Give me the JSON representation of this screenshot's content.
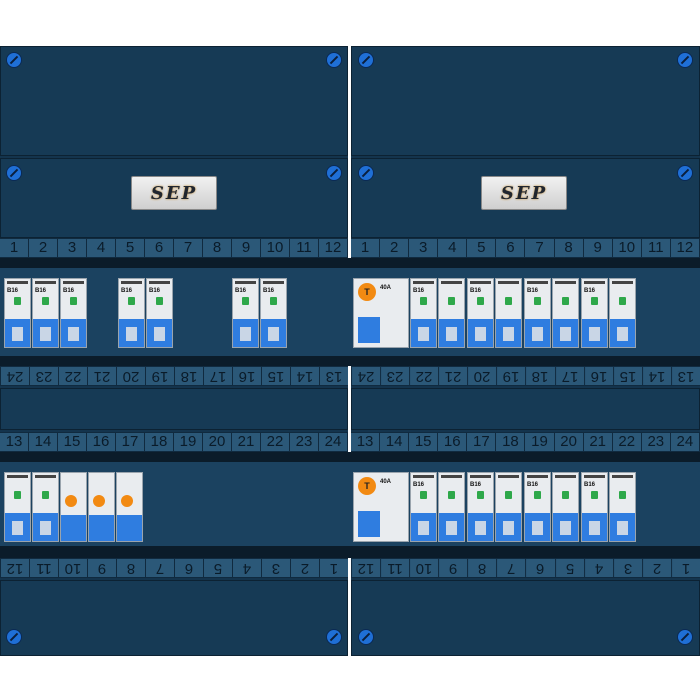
{
  "brand": {
    "logo_text": "SEP"
  },
  "top_row_numbers": [
    "1",
    "2",
    "3",
    "4",
    "5",
    "6",
    "7",
    "8",
    "9",
    "10",
    "11",
    "12"
  ],
  "bottom_row_numbers": [
    "13",
    "14",
    "15",
    "16",
    "17",
    "18",
    "19",
    "20",
    "21",
    "22",
    "23",
    "24"
  ],
  "breaker": {
    "rating": "B16"
  },
  "rcd": {
    "letter": "T",
    "rating": "40A"
  },
  "colors": {
    "panel": "#14344d",
    "screw": "#1f6fd6",
    "breaker_base": "#2f7de0",
    "rcd_button": "#f28a12",
    "led": "#2ea84a"
  }
}
